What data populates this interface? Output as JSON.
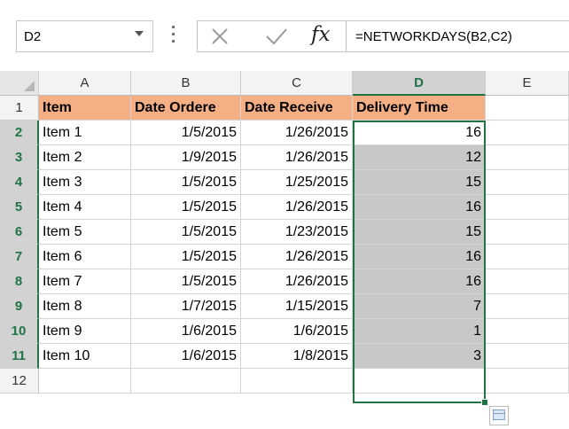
{
  "formula_bar": {
    "name_box": "D2",
    "fx_label": "fx",
    "formula": "=NETWORKDAYS(B2,C2)"
  },
  "columns": [
    "A",
    "B",
    "C",
    "D",
    "E"
  ],
  "rows": [
    "1",
    "2",
    "3",
    "4",
    "5",
    "6",
    "7",
    "8",
    "9",
    "10",
    "11",
    "12"
  ],
  "header": {
    "a": "Item",
    "b": "Date  Ordere",
    "c": "Date Receive",
    "d": "Delivery Time"
  },
  "data": [
    {
      "item": "Item 1",
      "ordered": "1/5/2015",
      "received": "1/26/2015",
      "delivery": "16"
    },
    {
      "item": "Item 2",
      "ordered": "1/9/2015",
      "received": "1/26/2015",
      "delivery": "12"
    },
    {
      "item": "Item 3",
      "ordered": "1/5/2015",
      "received": "1/25/2015",
      "delivery": "15"
    },
    {
      "item": "Item 4",
      "ordered": "1/5/2015",
      "received": "1/26/2015",
      "delivery": "16"
    },
    {
      "item": "Item 5",
      "ordered": "1/5/2015",
      "received": "1/23/2015",
      "delivery": "15"
    },
    {
      "item": "Item 6",
      "ordered": "1/5/2015",
      "received": "1/26/2015",
      "delivery": "16"
    },
    {
      "item": "Item 7",
      "ordered": "1/5/2015",
      "received": "1/26/2015",
      "delivery": "16"
    },
    {
      "item": "Item 8",
      "ordered": "1/7/2015",
      "received": "1/15/2015",
      "delivery": "7"
    },
    {
      "item": "Item 9",
      "ordered": "1/6/2015",
      "received": "1/6/2015",
      "delivery": "1"
    },
    {
      "item": "Item 10",
      "ordered": "1/6/2015",
      "received": "1/8/2015",
      "delivery": "3"
    }
  ],
  "selection": {
    "active_cell": "D2",
    "range": "D2:D11"
  },
  "colors": {
    "accent": "#217346",
    "header_fill": "#f4b084",
    "selected_fill": "#c8c8c8"
  }
}
